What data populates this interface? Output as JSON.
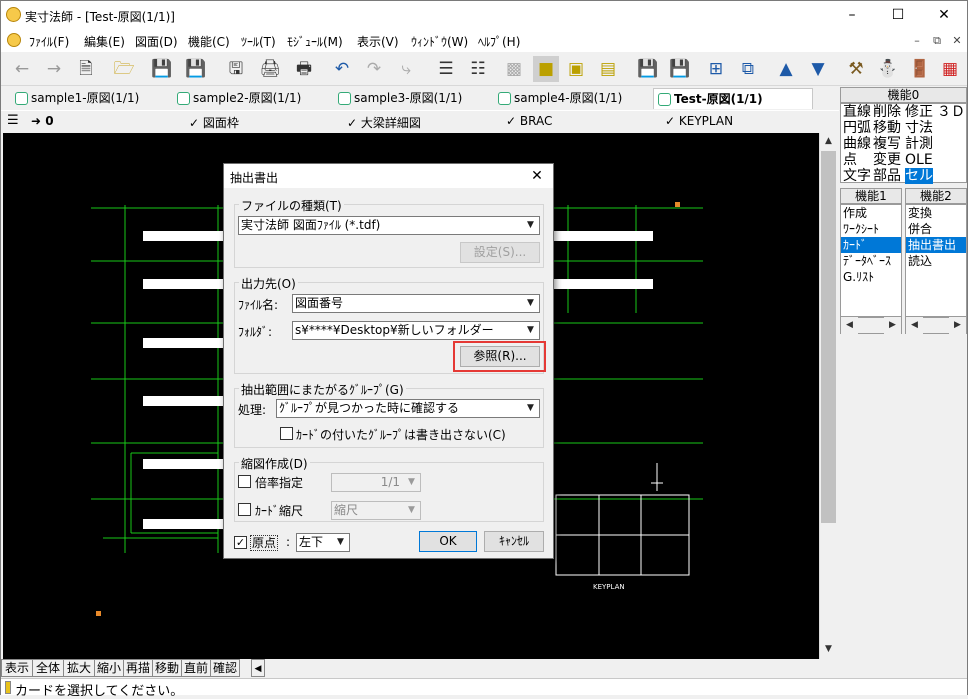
{
  "window": {
    "title": "実寸法師 - [Test-原図(1/1)]"
  },
  "menu": [
    {
      "label": "ﾌｧｲﾙ(F)"
    },
    {
      "label": "編集(E)"
    },
    {
      "label": "図面(D)"
    },
    {
      "label": "機能(C)"
    },
    {
      "label": "ﾂｰﾙ(T)"
    },
    {
      "label": "ﾓｼﾞｭｰﾙ(M)"
    },
    {
      "label": "表示(V)"
    },
    {
      "label": "ｳｨﾝﾄﾞｳ(W)"
    },
    {
      "label": "ﾍﾙﾌﾟ(H)"
    }
  ],
  "tabs": [
    {
      "label": "sample1-原図(1/1)"
    },
    {
      "label": "sample2-原図(1/1)"
    },
    {
      "label": "sample3-原図(1/1)"
    },
    {
      "label": "sample4-原図(1/1)"
    },
    {
      "label": "Test-原図(1/1)"
    }
  ],
  "layers": {
    "current": "0",
    "items": [
      {
        "label": "図面枠"
      },
      {
        "label": "大梁詳細図"
      },
      {
        "label": "BRAC"
      },
      {
        "label": "KEYPLAN"
      }
    ]
  },
  "panel0": {
    "title": "機能0",
    "rows": [
      [
        "直線",
        "削除",
        "修正",
        "３Ｄ"
      ],
      [
        "円弧",
        "移動",
        "寸法",
        ""
      ],
      [
        "曲線",
        "複写",
        "計測",
        ""
      ],
      [
        "点",
        "変更",
        "OLE",
        ""
      ],
      [
        "文字",
        "部品",
        "セル",
        ""
      ]
    ],
    "selected": "セル"
  },
  "panel1": {
    "title": "機能1",
    "items": [
      "作成",
      "ﾜｰｸｼｰﾄ",
      "ｶｰﾄﾞ",
      "ﾃﾞｰﾀﾍﾞｰｽ",
      "G.ﾘｽﾄ"
    ],
    "selected": "ｶｰﾄﾞ"
  },
  "panel2": {
    "title": "機能2",
    "items": [
      "変換",
      "併合",
      "抽出書出",
      "読込"
    ],
    "selected": "抽出書出"
  },
  "bottom_buttons": [
    "表示",
    "全体",
    "拡大",
    "縮小",
    "再描",
    "移動",
    "直前",
    "確認"
  ],
  "status": {
    "text": "カードを選択してください。"
  },
  "dialog": {
    "title": "抽出書出",
    "filetype_group": "ファイルの種類(T)",
    "filetype_value": "実寸法師 図面ﾌｧｲﾙ (*.tdf)",
    "settings_button": "設定(S)...",
    "output_group": "出力先(O)",
    "filename_label": "ﾌｧｲﾙ名:",
    "filename_value": "図面番号",
    "folder_label": "ﾌｫﾙﾀﾞ:",
    "folder_value": "s¥****¥Desktop¥新しいフォルダー",
    "browse_button": "参照(R)...",
    "group_group": "抽出範囲にまたがるｸﾞﾙｰﾌﾟ(G)",
    "process_label": "処理:",
    "process_value": "ｸﾞﾙｰﾌﾟが見つかった時に確認する",
    "card_check_label": "ｶｰﾄﾞの付いたｸﾞﾙｰﾌﾟは書き出さない(C)",
    "shrink_group": "縮図作成(D)",
    "ratio_label": "倍率指定",
    "ratio_value": "1/1",
    "card_scale_label": "ｶｰﾄﾞ縮尺",
    "card_scale_value": "縮尺",
    "origin_label": "原点",
    "origin_sep": ":",
    "origin_value": "左下",
    "ok_button": "OK",
    "cancel_button": "ｷｬﾝｾﾙ"
  },
  "canvas_texts": {
    "keyplan": "KEYPLAN"
  },
  "colors": {
    "accent": "#0078d7",
    "highlight": "#e53935",
    "canvas": "#000000",
    "cad_green": "#19c819"
  }
}
